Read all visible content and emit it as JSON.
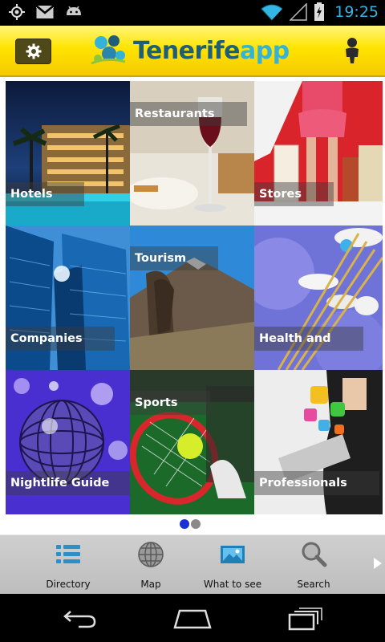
{
  "status_bar": {
    "time": "19:25",
    "left_icons": [
      "gps-icon",
      "gmail-icon",
      "android-icon"
    ],
    "right_icons": [
      "wifi-icon",
      "signal-icon",
      "battery-charging-icon"
    ]
  },
  "header": {
    "settings_icon": "gear-icon",
    "logo_part1": "Tenerife",
    "logo_part2": "app",
    "user_icon": "user-icon",
    "background_color": "#ffe400"
  },
  "tiles": [
    {
      "label": "Hotels",
      "label_position": "bottom"
    },
    {
      "label": "Restaurants",
      "label_position": "top"
    },
    {
      "label": "Stores",
      "label_position": "bottom"
    },
    {
      "label": "Companies",
      "label_position": "bottom"
    },
    {
      "label": "Tourism",
      "label_position": "top"
    },
    {
      "label": "Health and",
      "label_position": "bottom"
    },
    {
      "label": "Nightlife Guide",
      "label_position": "bottom"
    },
    {
      "label": "Sports",
      "label_position": "top"
    },
    {
      "label": "Professionals",
      "label_position": "bottom"
    }
  ],
  "pager": {
    "pages": 2,
    "current": 1,
    "active_color": "#1a2fd6",
    "inactive_color": "#8a8a8a"
  },
  "bottom_nav": {
    "items": [
      {
        "label": "Directory",
        "icon": "list-icon"
      },
      {
        "label": "Map",
        "icon": "globe-icon"
      },
      {
        "label": "What to see",
        "icon": "picture-icon"
      },
      {
        "label": "Search",
        "icon": "magnifier-icon"
      }
    ],
    "more_icon": "chevron-right-icon"
  },
  "system_nav": {
    "icons": [
      "back-icon",
      "home-icon",
      "recent-apps-icon"
    ]
  }
}
